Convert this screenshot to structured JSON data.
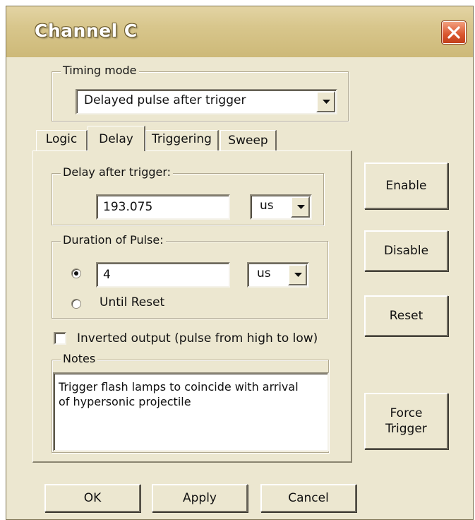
{
  "window": {
    "title": "Channel C",
    "colors": {
      "titlebar": "#d8c68c",
      "face": "#ece7d0",
      "close_button": "#d9562e"
    }
  },
  "timing_mode": {
    "legend": "Timing mode",
    "selected": "Delayed pulse after trigger"
  },
  "tabs": [
    {
      "label": "Logic",
      "active": false
    },
    {
      "label": "Delay",
      "active": true
    },
    {
      "label": "Triggering",
      "active": false
    },
    {
      "label": "Sweep",
      "active": false
    }
  ],
  "delay": {
    "legend": "Delay after trigger:",
    "value": "193.075",
    "unit": "us"
  },
  "duration": {
    "legend": "Duration of Pulse:",
    "value": "4",
    "unit": "us",
    "fixed_selected": true,
    "until_reset_label": "Until Reset"
  },
  "inverted_output": {
    "label": "Inverted output (pulse from high to low)",
    "checked": false
  },
  "notes": {
    "legend": "Notes",
    "text": "Trigger flash lamps to coincide with arrival\nof hypersonic projectile"
  },
  "side_buttons": {
    "enable": "Enable",
    "disable": "Disable",
    "reset": "Reset",
    "force_trigger": "Force Trigger"
  },
  "footer_buttons": {
    "ok": "OK",
    "apply": "Apply",
    "cancel": "Cancel"
  },
  "icons": {
    "close": "close-icon",
    "dropdown": "chevron-down-icon"
  }
}
